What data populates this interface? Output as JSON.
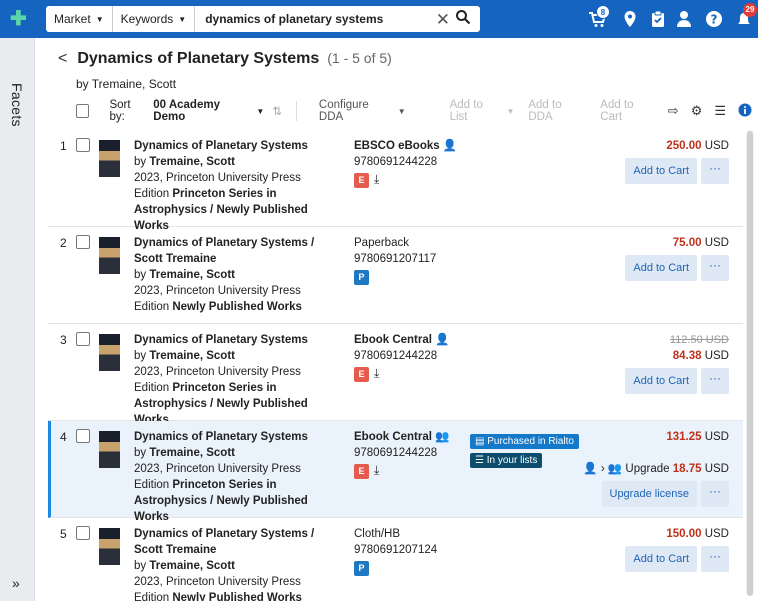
{
  "topbar": {
    "logo_icon": "binoculars-plus-icon",
    "scope": "Market",
    "field": "Keywords",
    "query": "dynamics of planetary systems",
    "clear_icon": "close-icon",
    "search_icon": "search-icon",
    "cart_badge": "8",
    "notif_badge": "29",
    "brand_color": "#1565c0"
  },
  "sidebar": {
    "facets_label": "Facets",
    "expand_icon": "»"
  },
  "header": {
    "back": "<",
    "title": "Dynamics of Planetary Systems",
    "count": "(1 - 5 of 5)",
    "author": "by Tremaine, Scott"
  },
  "toolbar": {
    "sort_prefix": "Sort by:",
    "sort_value": "00 Academy Demo",
    "configure": "Configure DDA",
    "add_list": "Add to List",
    "add_dda": "Add to DDA",
    "add_cart": "Add to Cart"
  },
  "results": [
    {
      "num": "1",
      "title": "Dynamics of Planetary Systems",
      "by": "by ",
      "author": "Tremaine, Scott",
      "pub": "2023, Princeton University Press",
      "ed_label": "Edition ",
      "edition": "Princeton Series in Astrophysics / Newly Published Works",
      "format": "EBSCO eBooks",
      "isbn": "9780691244228",
      "tag": "E",
      "price": "250.00",
      "currency": " USD",
      "btn": "Add to Cart",
      "more": "···"
    },
    {
      "num": "2",
      "title": "Dynamics of Planetary Systems / Scott Tremaine",
      "by": "by ",
      "author": "Tremaine, Scott",
      "pub": "2023, Princeton University Press",
      "ed_label": "Edition ",
      "edition": "Newly Published Works",
      "format": "Paperback",
      "isbn": "9780691207117",
      "tag": "P",
      "price": "75.00",
      "currency": " USD",
      "btn": "Add to Cart",
      "more": "···"
    },
    {
      "num": "3",
      "title": "Dynamics of Planetary Systems",
      "by": "by ",
      "author": "Tremaine, Scott",
      "pub": "2023, Princeton University Press",
      "ed_label": "Edition ",
      "edition": "Princeton Series in Astrophysics / Newly Published Works",
      "format": "Ebook Central",
      "isbn": "9780691244228",
      "tag": "E",
      "old_price": "112.50 USD",
      "price": "84.38",
      "currency": " USD",
      "btn": "Add to Cart",
      "more": "···"
    },
    {
      "num": "4",
      "title": "Dynamics of Planetary Systems",
      "by": "by ",
      "author": "Tremaine, Scott",
      "pub": "2023, Princeton University Press",
      "ed_label": "Edition ",
      "edition": "Princeton Series in Astrophysics / Newly Published Works",
      "format": "Ebook Central",
      "isbn": "9780691244228",
      "tag": "E",
      "chip1": "Purchased in Rialto",
      "chip2": "In your lists",
      "price": "131.25",
      "currency": " USD",
      "upgrade_label": " Upgrade ",
      "upgrade_price": "18.75",
      "btn": "Upgrade license",
      "more": "···"
    },
    {
      "num": "5",
      "title": "Dynamics of Planetary Systems / Scott Tremaine",
      "by": "by ",
      "author": "Tremaine, Scott",
      "pub": "2023, Princeton University Press",
      "ed_label": "Edition ",
      "edition": "Newly Published Works",
      "format": "Cloth/HB",
      "isbn": "9780691207124",
      "tag": "P",
      "price": "150.00",
      "currency": " USD",
      "btn": "Add to Cart",
      "more": "···"
    }
  ]
}
